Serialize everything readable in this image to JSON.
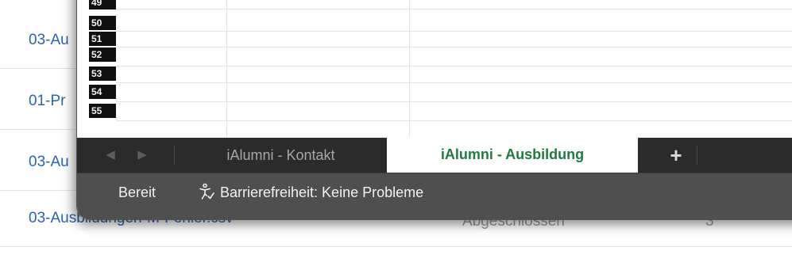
{
  "background_list": {
    "rows": [
      {
        "link": "03-Au",
        "status": "",
        "num": ""
      },
      {
        "link": "01-Pr",
        "status": "",
        "num": ""
      },
      {
        "link": "03-Au",
        "status": "",
        "num": ""
      },
      {
        "link": "03-Ausbildungen-M-Fehler.csv",
        "status": "Abgeschlossen",
        "num": "3"
      }
    ]
  },
  "spreadsheet": {
    "row_headers": [
      "49",
      "50",
      "51",
      "52",
      "53",
      "54",
      "55"
    ],
    "tabs": [
      {
        "label": "iAlumni - Kontakt",
        "active": false
      },
      {
        "label": "iAlumni - Ausbildung",
        "active": true
      }
    ],
    "add_tab_label": "+",
    "nav_prev": "◀",
    "nav_next": "▶"
  },
  "status_bar": {
    "ready": "Bereit",
    "accessibility": "Barrierefreiheit: Keine Probleme"
  },
  "colors": {
    "active_tab_text": "#1f7a3e",
    "link": "#2a63b2",
    "status_bar_bg": "#4f4f4f",
    "tab_bar_bg": "#2b2b2b"
  }
}
